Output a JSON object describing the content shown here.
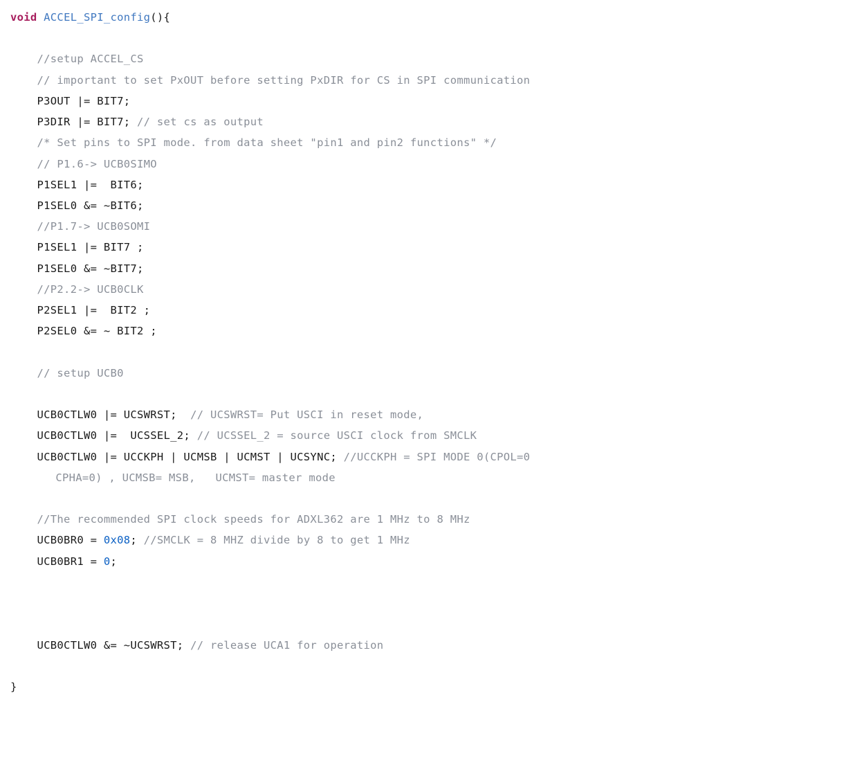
{
  "code": {
    "l1_kw": "void",
    "l1_fn": "ACCEL_SPI_config",
    "l1_rest": "(){",
    "l2_cm": "//setup ACCEL_CS",
    "l3_cm": "// important to set PxOUT before setting PxDIR for CS in SPI communication",
    "l4": "P3OUT |= BIT7;",
    "l5_code": "P3DIR |= BIT7; ",
    "l5_cm": "// set cs as output",
    "l6_cm": "/* Set pins to SPI mode. from data sheet \"pin1 and pin2 functions\" */",
    "l7_cm": "// P1.6-> UCB0SIMO",
    "l8": "P1SEL1 |=  BIT6;",
    "l9": "P1SEL0 &= ~BIT6;",
    "l10_cm": "//P1.7-> UCB0SOMI",
    "l11": "P1SEL1 |= BIT7 ;",
    "l12": "P1SEL0 &= ~BIT7;",
    "l13_cm": "//P2.2-> UCB0CLK",
    "l14": "P2SEL1 |=  BIT2 ;",
    "l15": "P2SEL0 &= ~ BIT2 ;",
    "l16_cm": "// setup UCB0",
    "l17_code": "UCB0CTLW0 |= UCSWRST;  ",
    "l17_cm": "// UCSWRST= Put USCI in reset mode,",
    "l18_code": "UCB0CTLW0 |=  UCSSEL_2; ",
    "l18_cm": "// UCSSEL_2 = source USCI clock from SMCLK",
    "l19_code": "UCB0CTLW0 |= UCCKPH | UCMSB | UCMST | UCSYNC; ",
    "l19_cm_a": "//UCCKPH = SPI MODE 0(CPOL=0 ",
    "l19_cm_b": "CPHA=0) , UCMSB= MSB,   UCMST= master mode",
    "l20_cm": "//The recommended SPI clock speeds for ADXL362 are 1 MHz to 8 MHz",
    "l21_code_a": "UCB0BR0 = ",
    "l21_num": "0x08",
    "l21_code_b": "; ",
    "l21_cm": "//SMCLK = 8 MHZ divide by 8 to get 1 MHz",
    "l22_code_a": "UCB0BR1 = ",
    "l22_num": "0",
    "l22_code_b": ";",
    "l23_code": "UCB0CTLW0 &= ~UCSWRST; ",
    "l23_cm": "// release UCA1 for operation",
    "l24": "}"
  }
}
